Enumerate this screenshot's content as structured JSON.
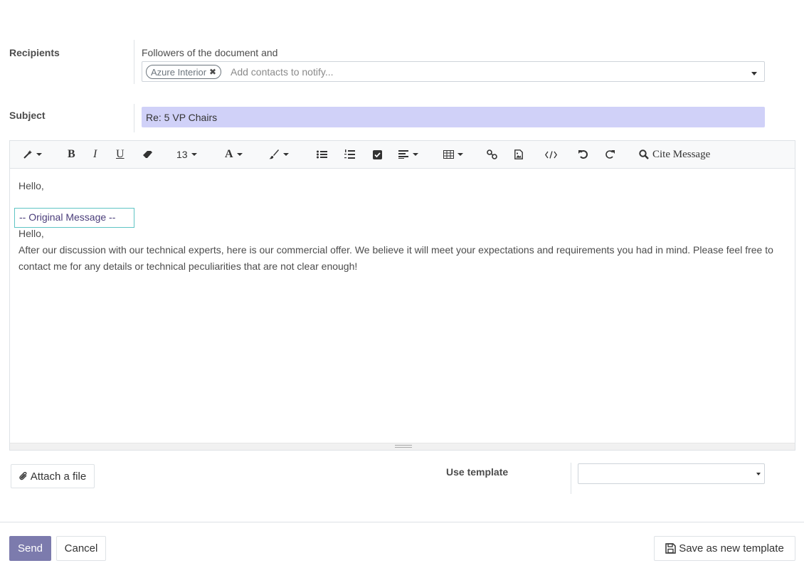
{
  "recipients": {
    "label": "Recipients",
    "followers_text": "Followers of the document and",
    "tags": [
      {
        "label": "Azure Interior"
      }
    ],
    "placeholder": "Add contacts to notify..."
  },
  "subject": {
    "label": "Subject",
    "value": "Re: 5 VP Chairs"
  },
  "toolbar": {
    "font_size": "13",
    "cite_label": "Cite Message",
    "buttons": [
      "magic-wand",
      "bold",
      "italic",
      "underline",
      "eraser",
      "font-size",
      "font-color",
      "background-color",
      "bullet-list",
      "numbered-list",
      "checklist",
      "align",
      "table",
      "link",
      "image",
      "code-view",
      "undo",
      "redo",
      "cite-message"
    ],
    "bold_glyph": "B",
    "italic_glyph": "I",
    "underline_glyph": "U",
    "font_color_glyph": "A"
  },
  "body": {
    "greeting": "Hello,",
    "original_header": "-- Original Message --",
    "quoted_greeting": "Hello,",
    "quoted_text": "After our discussion with our technical experts, here is our commercial offer. We believe it will meet your expectations and requirements you had in mind. Please feel free to contact me for any details or technical peculiarities that are not clear enough!"
  },
  "attach": {
    "label": "Attach a file"
  },
  "template": {
    "label": "Use template",
    "selected": ""
  },
  "actions": {
    "send": "Send",
    "cancel": "Cancel",
    "save_template": "Save as new template"
  },
  "colors": {
    "subject_bg": "#d0d1f8",
    "primary": "#7c7bad",
    "highlight_border": "#5fc4c4"
  }
}
